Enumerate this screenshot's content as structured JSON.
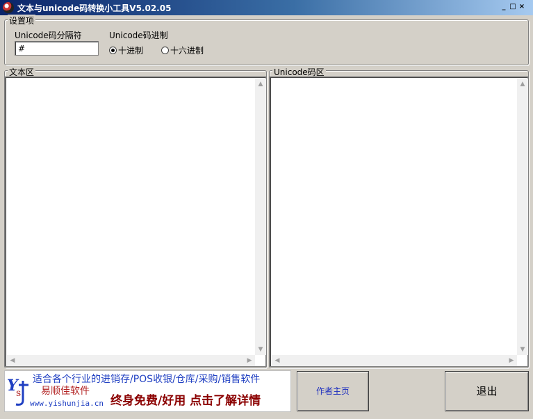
{
  "window": {
    "title": "文本与unicode码转换小工具V5.02.05",
    "controls": {
      "minimize": "_",
      "maximize": "□",
      "close": "×"
    }
  },
  "settings": {
    "group_label": "设置项",
    "separator_label": "Unicode码分隔符",
    "separator_value": "#",
    "base_label": "Unicode码进制",
    "radio_decimal": "十进制",
    "radio_hex": "十六进制",
    "selected": "decimal"
  },
  "text_area": {
    "label": "文本区",
    "value": ""
  },
  "unicode_area": {
    "label": "Unicode码区",
    "value": ""
  },
  "ad": {
    "line1": "适合各个行业的进销存/POS收银/仓库/采购/销售软件",
    "brand": "易顺佳软件",
    "url": "www.yishunjia.cn",
    "slogan": "终身免费/好用 点击了解详情"
  },
  "buttons": {
    "author_home": "作者主页",
    "exit": "退出"
  },
  "colors": {
    "titlebar_start": "#0a246a",
    "titlebar_end": "#a6caf0",
    "link_blue": "#1f3fc2",
    "brand_red": "#b22222"
  }
}
